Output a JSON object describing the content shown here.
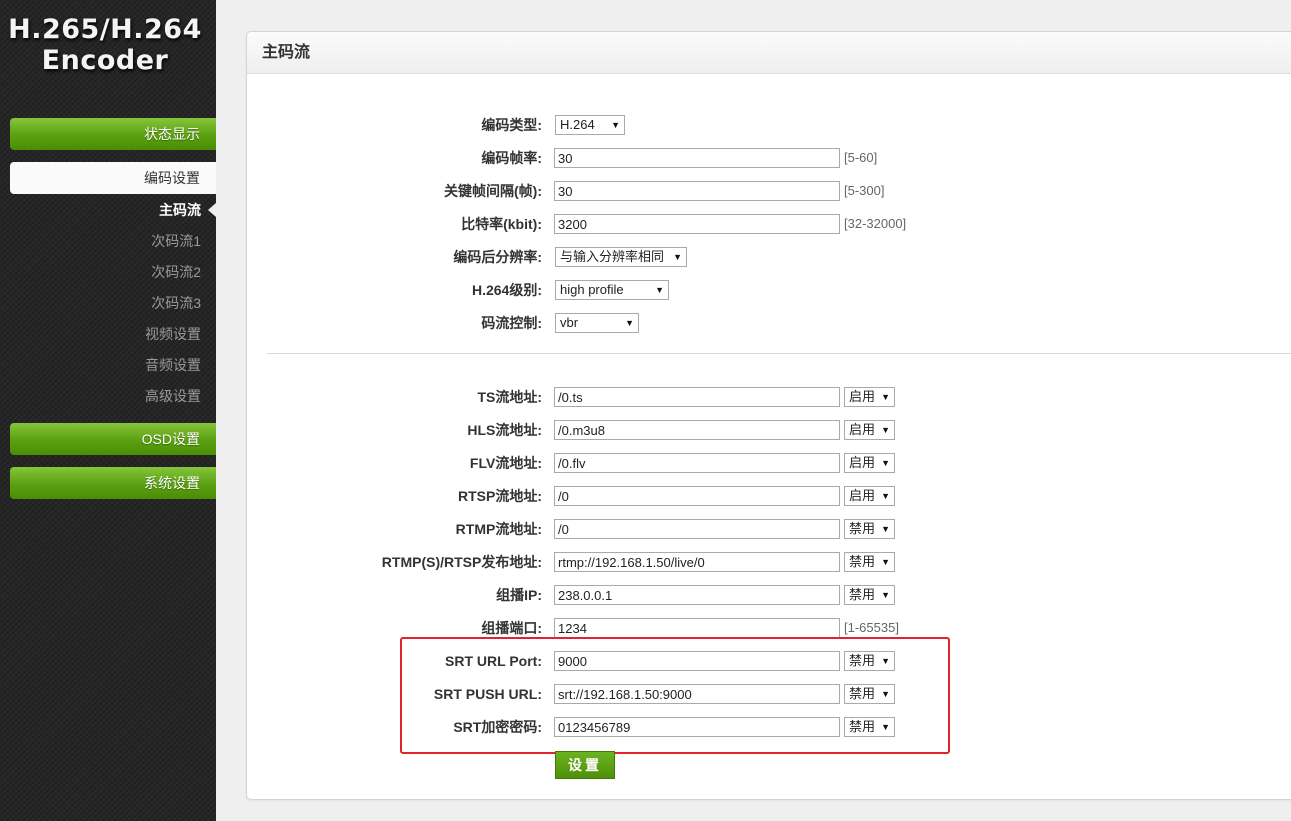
{
  "logo": {
    "line1": "H.265/H.264",
    "line2": "Encoder"
  },
  "sidebar": {
    "status": "状态显示",
    "encode": "编码设置",
    "sub_items": [
      "主码流",
      "次码流1",
      "次码流2",
      "次码流3",
      "视频设置",
      "音频设置",
      "高级设置"
    ],
    "osd": "OSD设置",
    "system": "系统设置"
  },
  "panel": {
    "title": "主码流"
  },
  "encode": {
    "codec": {
      "label": "编码类型:",
      "value": "H.264"
    },
    "fps": {
      "label": "编码帧率:",
      "value": "30",
      "hint": "[5-60]"
    },
    "gop": {
      "label": "关键帧间隔(帧):",
      "value": "30",
      "hint": "[5-300]"
    },
    "bitrate": {
      "label": "比特率(kbit):",
      "value": "3200",
      "hint": "[32-32000]"
    },
    "resolution": {
      "label": "编码后分辨率:",
      "value": "与输入分辨率相同"
    },
    "profile": {
      "label": "H.264级别:",
      "value": "high profile"
    },
    "rc": {
      "label": "码流控制:",
      "value": "vbr"
    }
  },
  "stream": {
    "ts": {
      "label": "TS流地址:",
      "value": "/0.ts",
      "state": "启用"
    },
    "hls": {
      "label": "HLS流地址:",
      "value": "/0.m3u8",
      "state": "启用"
    },
    "flv": {
      "label": "FLV流地址:",
      "value": "/0.flv",
      "state": "启用"
    },
    "rtsp": {
      "label": "RTSP流地址:",
      "value": "/0",
      "state": "启用"
    },
    "rtmp": {
      "label": "RTMP流地址:",
      "value": "/0",
      "state": "禁用"
    },
    "publish": {
      "label": "RTMP(S)/RTSP发布地址:",
      "value": "rtmp://192.168.1.50/live/0",
      "state": "禁用"
    },
    "mcast_ip": {
      "label": "组播IP:",
      "value": "238.0.0.1",
      "state": "禁用"
    },
    "mcast_port": {
      "label": "组播端口:",
      "value": "1234",
      "hint": "[1-65535]"
    },
    "srt_port": {
      "label": "SRT URL Port:",
      "value": "9000",
      "state": "禁用"
    },
    "srt_push": {
      "label": "SRT PUSH URL:",
      "value": "srt://192.168.1.50:9000",
      "state": "禁用"
    },
    "srt_key": {
      "label": "SRT加密密码:",
      "value": "0123456789",
      "state": "禁用"
    }
  },
  "submit_label": "设置",
  "colors": {
    "accent_green": "#5aa010",
    "highlight_red": "#e0232c"
  },
  "icons": {
    "dropdown": "▼"
  }
}
